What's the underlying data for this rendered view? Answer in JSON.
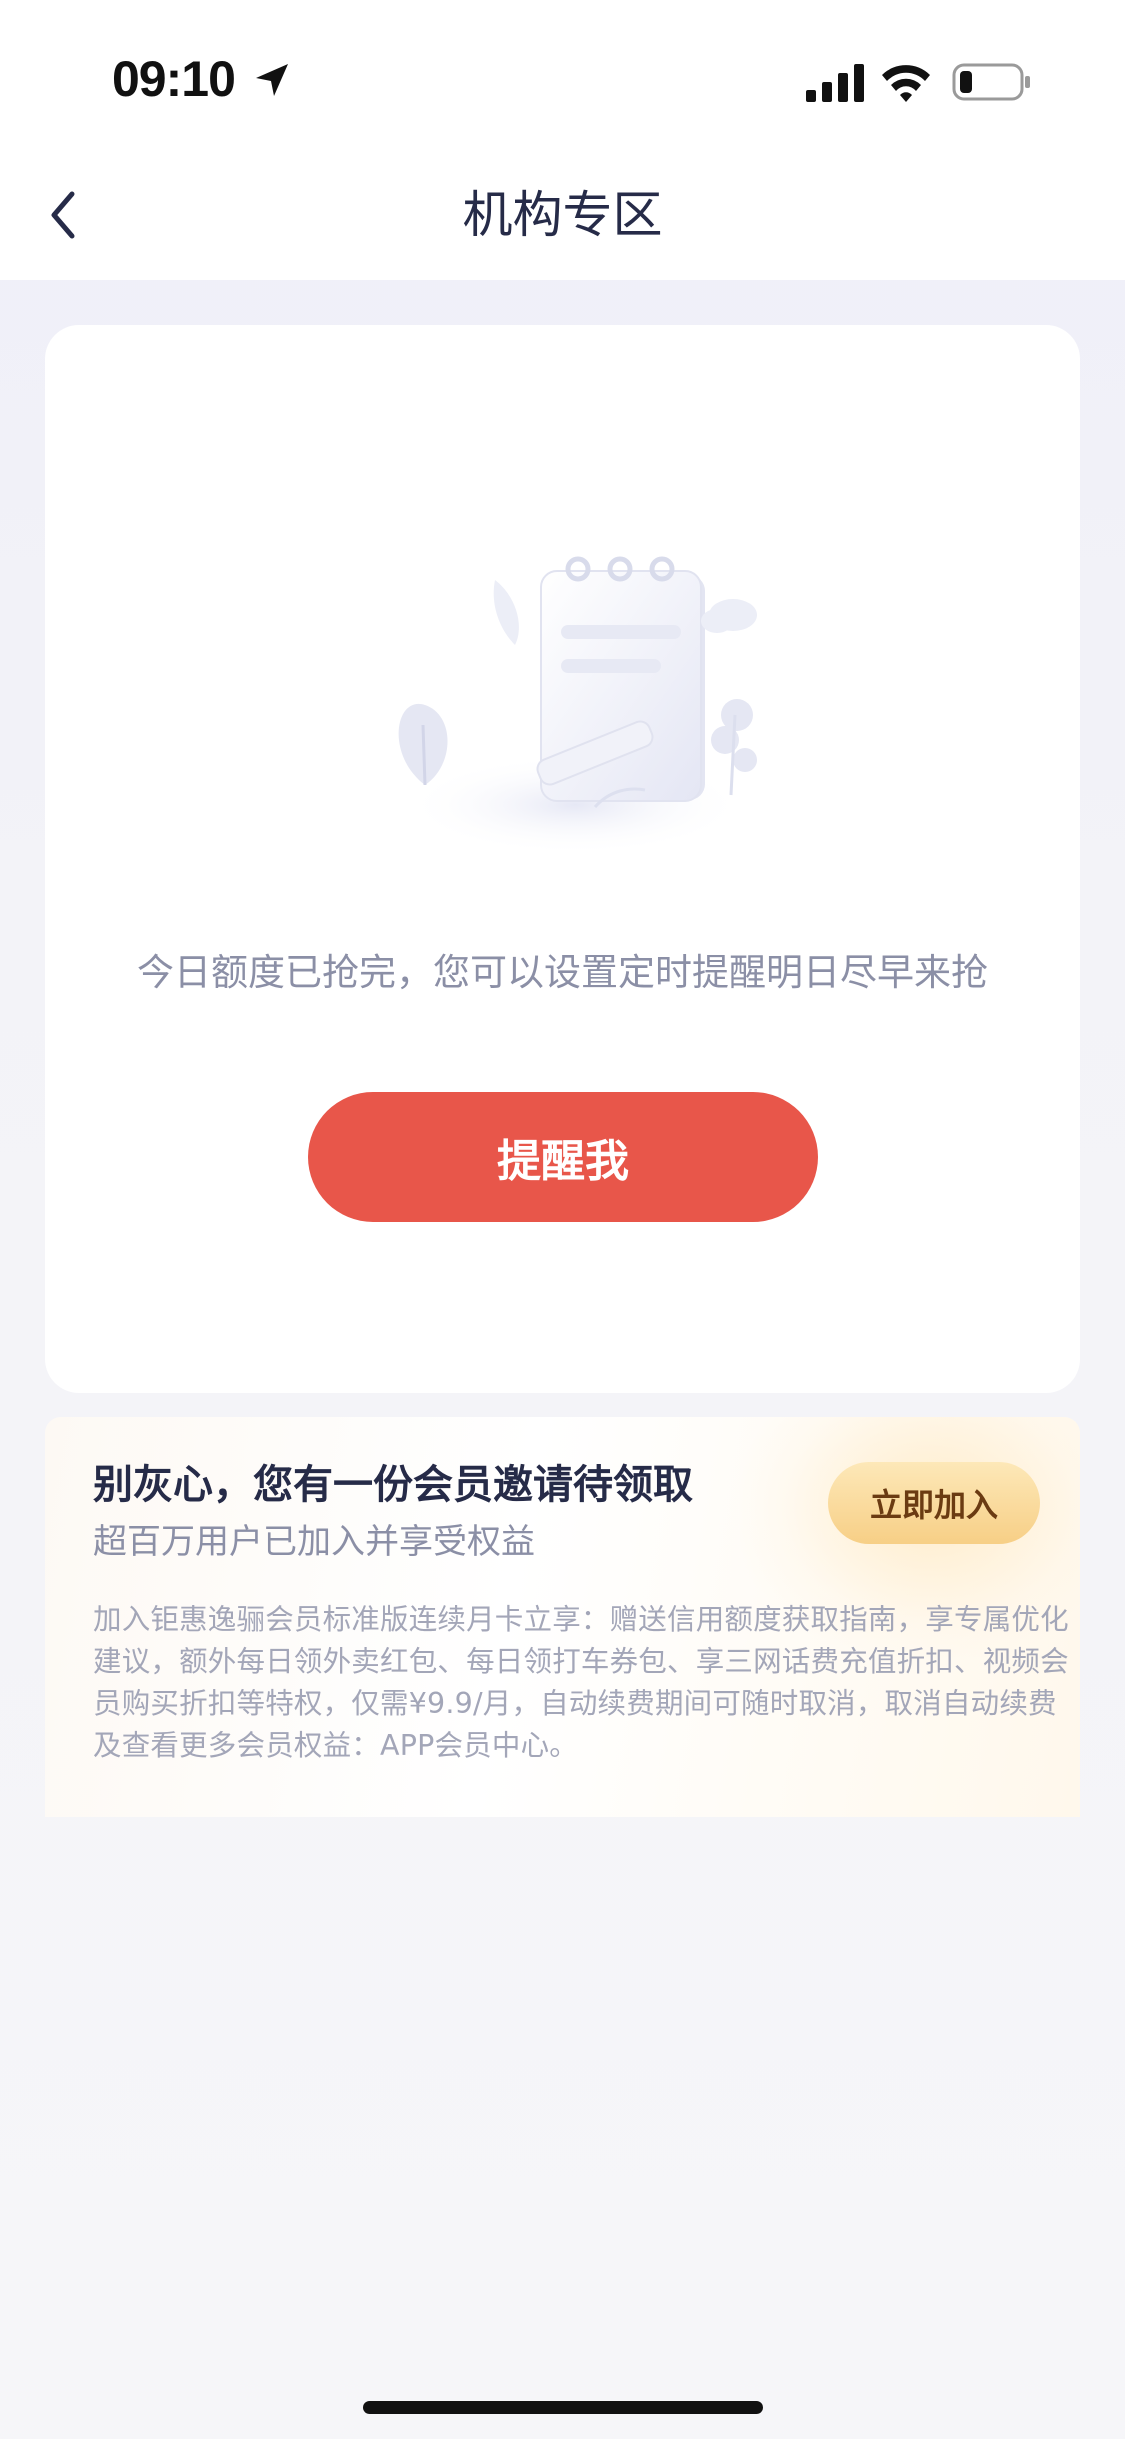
{
  "status_bar": {
    "time": "09:10"
  },
  "nav": {
    "title": "机构专区"
  },
  "empty_state": {
    "message": "今日额度已抢完，您可以设置定时提醒明日尽早来抢",
    "button_label": "提醒我"
  },
  "membership": {
    "title": "别灰心，您有一份会员邀请待领取",
    "subtitle": "超百万用户已加入并享受权益",
    "join_label": "立即加入",
    "description": "加入钜惠逸骊会员标准版连续月卡立享：赠送信用额度获取指南，享专属优化建议，额外每日领外卖红包、每日领打车券包、享三网话费充值折扣、视频会员购买折扣等特权，仅需¥9.9/月，自动续费期间可随时取消，取消自动续费及查看更多会员权益：APP会员中心。"
  },
  "colors": {
    "accent_button": "#e8564a",
    "join_button": "#f7cf86",
    "title_text": "#262b48",
    "muted_text": "#8b8fa6"
  },
  "icons": [
    "location-arrow-icon",
    "cellular-signal-icon",
    "wifi-icon",
    "battery-icon",
    "back-chevron-icon",
    "empty-notebook-illustration"
  ]
}
